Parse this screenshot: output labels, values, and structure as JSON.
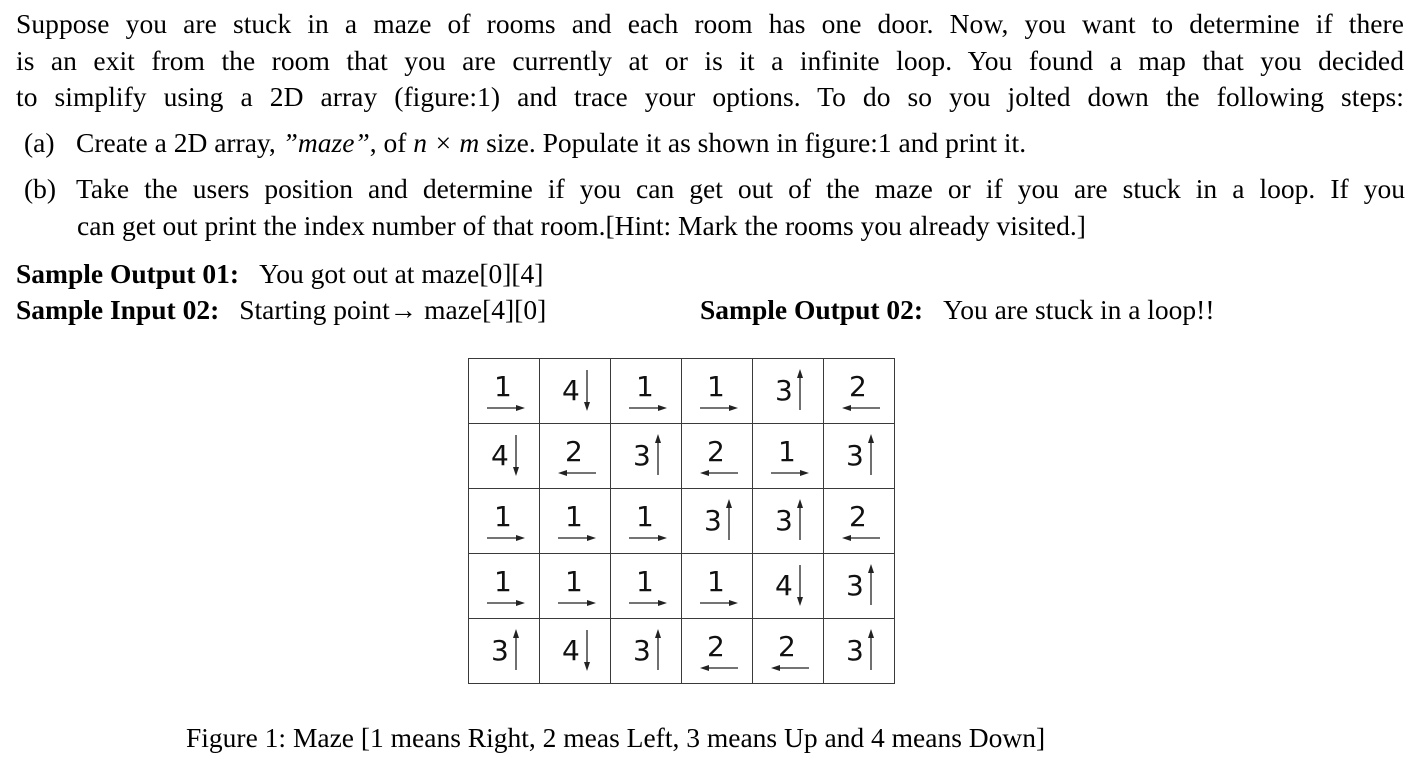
{
  "intro": {
    "lines": [
      "Suppose you are stuck in a maze of rooms and each room has one door. Now, you want to determine if there",
      "is an exit from the room that you are currently at or is it a infinite loop. You found a map that you decided",
      "to simplify using a 2D array (figure:1) and trace your options. To do so you jolted down the following steps:"
    ]
  },
  "steps": [
    {
      "label": "(a)",
      "text_before": "Create a 2D array, ",
      "text_italic": "”maze”",
      "text_mid": ", of ",
      "text_math": "n × m",
      "text_after": " size. Populate it as shown in figure:1 and print it."
    },
    {
      "label": "(b)",
      "line1": "Take the users position and determine if you can get out of the maze or if you are stuck in a loop. If you",
      "line2": "can get out print the index number of that room.[Hint: Mark the rooms you already visited.]"
    }
  ],
  "samples": {
    "output01_label": "Sample Output 01:",
    "output01_value": "You got out at maze[0][4]",
    "input02_label": "Sample Input 02:",
    "input02_value": "Starting point→ maze[4][0]",
    "output02_label": "Sample Output 02:",
    "output02_value": "You are stuck in a loop!!"
  },
  "maze": {
    "rows": [
      [
        1,
        4,
        1,
        1,
        3,
        2
      ],
      [
        4,
        2,
        3,
        2,
        1,
        3
      ],
      [
        1,
        1,
        1,
        3,
        3,
        2
      ],
      [
        1,
        1,
        1,
        1,
        4,
        3
      ],
      [
        3,
        4,
        3,
        2,
        2,
        3
      ]
    ],
    "direction_legend": {
      "1": "right",
      "2": "left",
      "3": "up",
      "4": "down"
    }
  },
  "caption": "Figure 1: Maze [1 means Right, 2 meas Left, 3 means Up and 4 means Down]"
}
